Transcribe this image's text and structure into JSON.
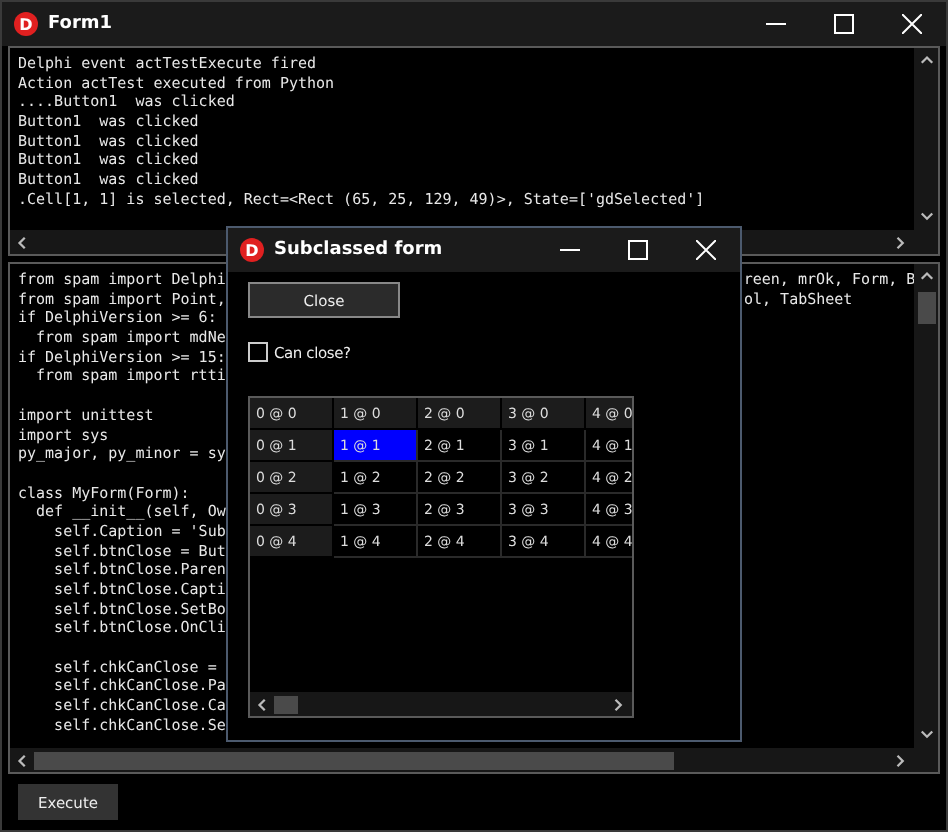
{
  "window": {
    "logo": "D",
    "title": "Form1"
  },
  "output": {
    "lines": [
      "Delphi event actTestExecute fired",
      "Action actTest executed from Python",
      "....Button1  was clicked",
      "Button1  was clicked",
      "Button1  was clicked",
      "Button1  was clicked",
      "Button1  was clicked",
      ".Cell[1, 1] is selected, Rect=<Rect (65, 25, 129, 49)>, State=['gdSelected']"
    ]
  },
  "code": {
    "lines": [
      {
        "kind": "text",
        "left": "from spam import Delphi",
        "right": "reen, mrOk, Form, B"
      },
      {
        "kind": "text",
        "left": "from spam import Point,",
        "right": "ol, TabSheet"
      },
      {
        "kind": "text",
        "left": "if DelphiVersion >= 6:"
      },
      {
        "kind": "text",
        "left": "  from spam import mdNe"
      },
      {
        "kind": "text",
        "left": "if DelphiVersion >= 15:"
      },
      {
        "kind": "text",
        "left": "  from spam import rtti"
      },
      {
        "kind": "blank"
      },
      {
        "kind": "text",
        "left": "import unittest"
      },
      {
        "kind": "text",
        "left": "import sys"
      },
      {
        "kind": "text",
        "left": "py_major, py_minor = sy"
      },
      {
        "kind": "blank"
      },
      {
        "kind": "text",
        "left": "class MyForm(Form):"
      },
      {
        "kind": "text",
        "left": "  def __init__(self, Ow"
      },
      {
        "kind": "text",
        "left": "    self.Caption = 'Sub"
      },
      {
        "kind": "text",
        "left": "    self.btnClose = But"
      },
      {
        "kind": "text",
        "left": "    self.btnClose.Paren"
      },
      {
        "kind": "text",
        "left": "    self.btnClose.Capti"
      },
      {
        "kind": "text",
        "left": "    self.btnClose.SetBo"
      },
      {
        "kind": "text",
        "left": "    self.btnClose.OnCli"
      },
      {
        "kind": "blank"
      },
      {
        "kind": "text",
        "left": "    self.chkCanClose ="
      },
      {
        "kind": "text",
        "left": "    self.chkCanClose.Pa"
      },
      {
        "kind": "text",
        "left": "    self.chkCanClose.Ca"
      },
      {
        "kind": "text",
        "left": "    self.chkCanClose.Se"
      }
    ]
  },
  "execute_button": "Execute",
  "dialog": {
    "logo": "D",
    "title": "Subclassed form",
    "close_button": "Close",
    "checkbox": {
      "label": "Can close?",
      "checked": false
    },
    "grid": {
      "rows": [
        [
          {
            "text": "0 @ 0",
            "kind": "fixed",
            "selected": false
          },
          {
            "text": "1 @ 0",
            "kind": "fixed",
            "selected": false
          },
          {
            "text": "2 @ 0",
            "kind": "fixed",
            "selected": false
          },
          {
            "text": "3 @ 0",
            "kind": "fixed",
            "selected": false
          },
          {
            "text": "4 @ 0",
            "kind": "fixed",
            "selected": false
          }
        ],
        [
          {
            "text": "0 @ 1",
            "kind": "fixed",
            "selected": false
          },
          {
            "text": "1 @ 1",
            "kind": "cell",
            "selected": true
          },
          {
            "text": "2 @ 1",
            "kind": "cell",
            "selected": false
          },
          {
            "text": "3 @ 1",
            "kind": "cell",
            "selected": false
          },
          {
            "text": "4 @ 1",
            "kind": "cell",
            "selected": false
          }
        ],
        [
          {
            "text": "0 @ 2",
            "kind": "fixed",
            "selected": false
          },
          {
            "text": "1 @ 2",
            "kind": "cell",
            "selected": false
          },
          {
            "text": "2 @ 2",
            "kind": "cell",
            "selected": false
          },
          {
            "text": "3 @ 2",
            "kind": "cell",
            "selected": false
          },
          {
            "text": "4 @ 2",
            "kind": "cell",
            "selected": false
          }
        ],
        [
          {
            "text": "0 @ 3",
            "kind": "fixed",
            "selected": false
          },
          {
            "text": "1 @ 3",
            "kind": "cell",
            "selected": false
          },
          {
            "text": "2 @ 3",
            "kind": "cell",
            "selected": false
          },
          {
            "text": "3 @ 3",
            "kind": "cell",
            "selected": false
          },
          {
            "text": "4 @ 3",
            "kind": "cell",
            "selected": false
          }
        ],
        [
          {
            "text": "0 @ 4",
            "kind": "fixed",
            "selected": false
          },
          {
            "text": "1 @ 4",
            "kind": "cell",
            "selected": false
          },
          {
            "text": "2 @ 4",
            "kind": "cell",
            "selected": false
          },
          {
            "text": "3 @ 4",
            "kind": "cell",
            "selected": false
          },
          {
            "text": "4 @ 4",
            "kind": "cell",
            "selected": false
          }
        ]
      ]
    }
  }
}
